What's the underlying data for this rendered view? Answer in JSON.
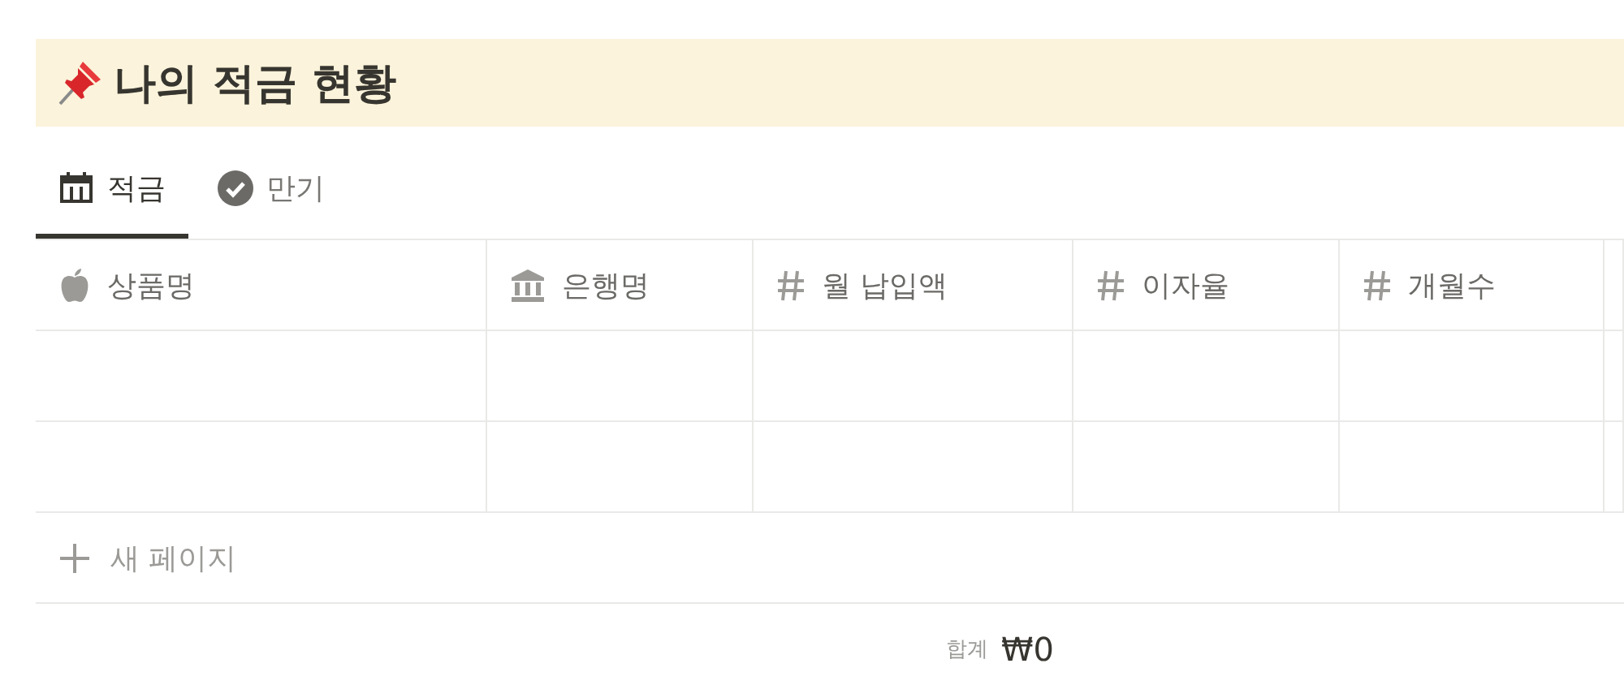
{
  "title": "나의 적금 현황",
  "tabs": [
    {
      "label": "적금",
      "kind": "calendar",
      "selected": true
    },
    {
      "label": "만기",
      "kind": "check",
      "selected": false
    }
  ],
  "table": {
    "columns": [
      {
        "label": "상품명",
        "kind": "apple"
      },
      {
        "label": "은행명",
        "kind": "bank"
      },
      {
        "label": "월 납입액",
        "kind": "number",
        "sum": {
          "label": "합계",
          "value": "₩0"
        }
      },
      {
        "label": "이자율",
        "kind": "number"
      },
      {
        "label": "개월수",
        "kind": "number"
      }
    ],
    "rows": [
      {
        "kind": "empty"
      },
      {
        "kind": "empty"
      }
    ],
    "new_row": "새 페이지"
  }
}
